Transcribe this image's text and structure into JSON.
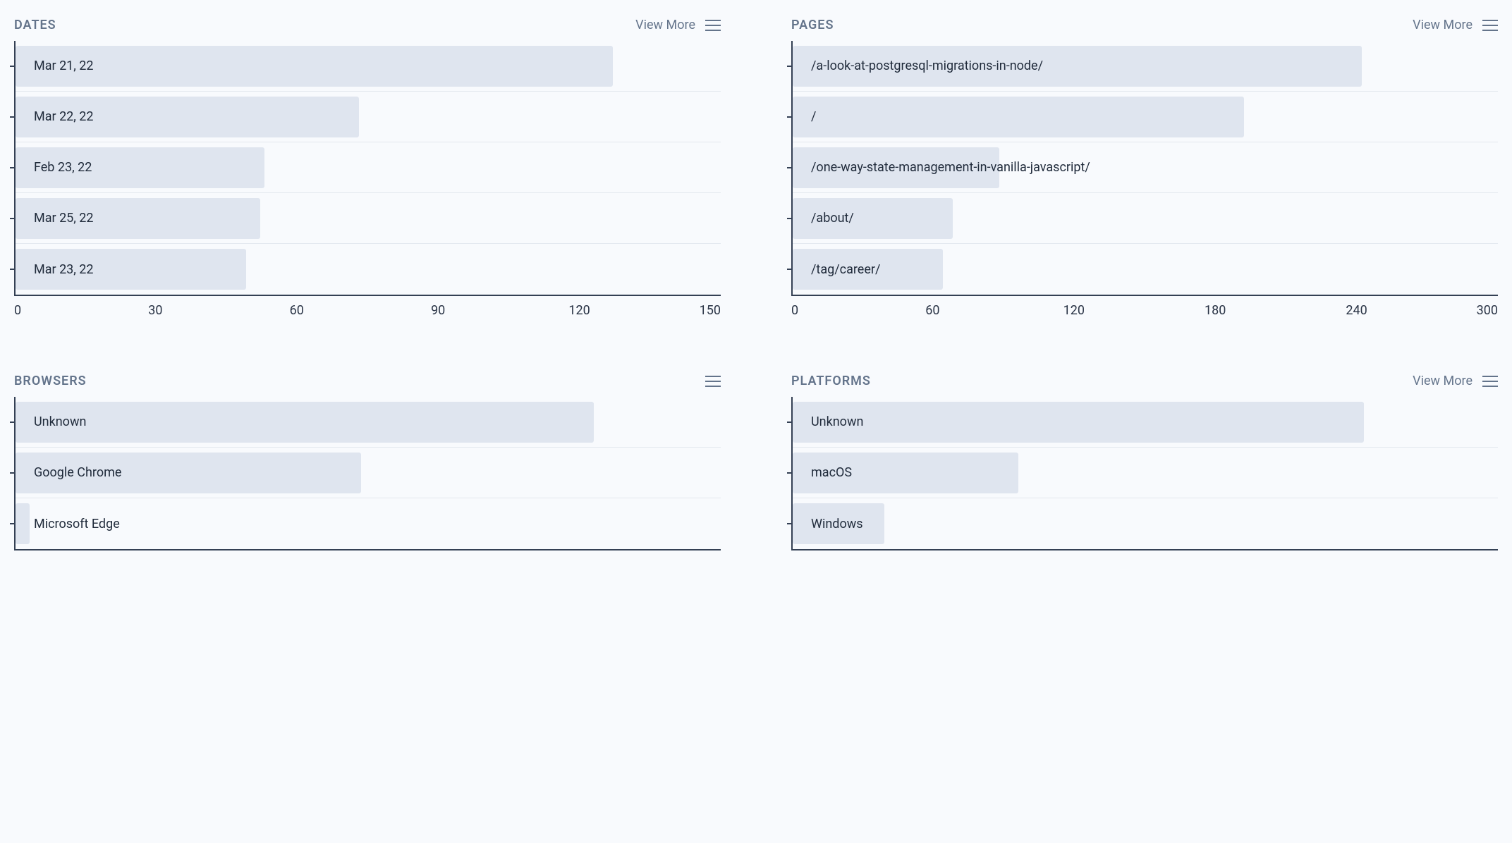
{
  "viewMoreLabel": "View More",
  "chart_data": [
    {
      "key": "dates",
      "title": "DATES",
      "type": "bar",
      "hasViewMore": true,
      "hasAxis": true,
      "xmax": 150,
      "ticks": [
        "0",
        "30",
        "60",
        "90",
        "120",
        "150"
      ],
      "categories": [
        "Mar 21, 22",
        "Mar 22, 22",
        "Feb 23, 22",
        "Mar 25, 22",
        "Mar 23, 22"
      ],
      "values": [
        127,
        73,
        53,
        52,
        49
      ]
    },
    {
      "key": "pages",
      "title": "PAGES",
      "type": "bar",
      "hasViewMore": true,
      "hasAxis": true,
      "xmax": 300,
      "ticks": [
        "0",
        "60",
        "120",
        "180",
        "240",
        "300"
      ],
      "categories": [
        "/a-look-at-postgresql-migrations-in-node/",
        "/",
        "/one-way-state-management-in-vanilla-javascript/",
        "/about/",
        "/tag/career/"
      ],
      "values": [
        242,
        192,
        88,
        68,
        64
      ]
    },
    {
      "key": "browsers",
      "title": "BROWSERS",
      "type": "bar",
      "hasViewMore": false,
      "hasAxis": false,
      "xmax": 100,
      "ticks": [],
      "categories": [
        "Unknown",
        "Google Chrome",
        "Microsoft Edge"
      ],
      "values": [
        82,
        49,
        2
      ]
    },
    {
      "key": "platforms",
      "title": "PLATFORMS",
      "type": "bar",
      "hasViewMore": true,
      "hasAxis": false,
      "xmax": 100,
      "ticks": [],
      "categories": [
        "Unknown",
        "macOS",
        "Windows"
      ],
      "values": [
        81,
        32,
        13
      ]
    }
  ]
}
